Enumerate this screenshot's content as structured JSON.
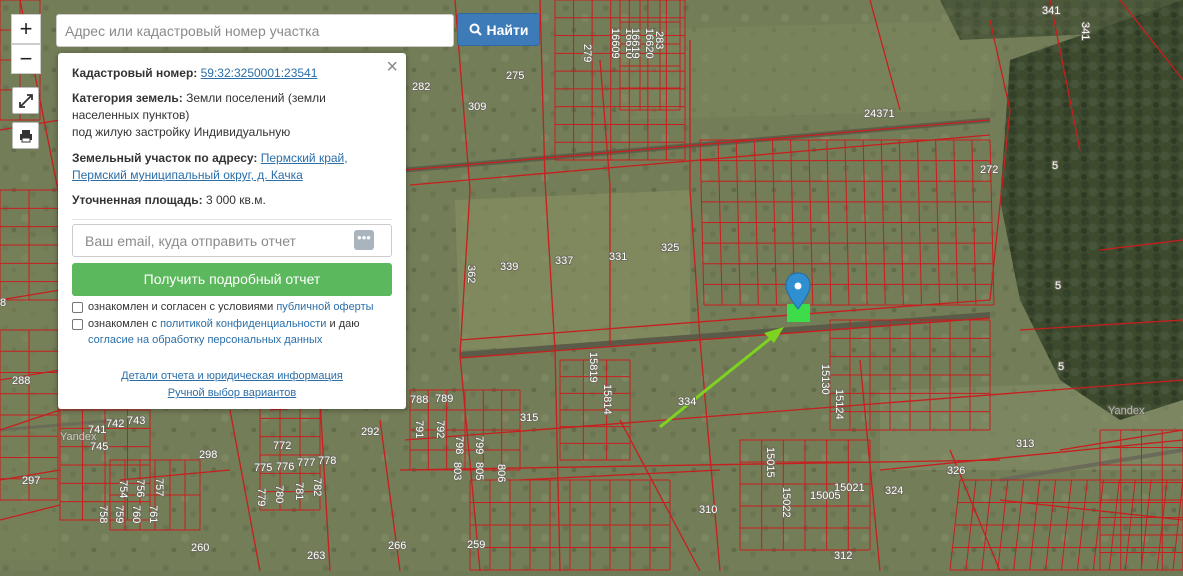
{
  "search": {
    "placeholder": "Адрес или кадастровый номер участка",
    "button_label": "Найти",
    "button_icon": "search-icon"
  },
  "map_controls": {
    "zoom_in": "+",
    "zoom_out": "−",
    "fullscreen_icon": "expand-icon",
    "print_icon": "printer-icon"
  },
  "popup": {
    "cadastral_label": "Кадастровый номер:",
    "cadastral_number": "59:32:3250001:23541",
    "category_label": "Категория земель:",
    "category_text1": "Земли поселений (земли",
    "category_text2": "населенных пунктов)",
    "category_text3": "под жилую застройку Индивидуальную",
    "address_label": "Земельный участок по адресу:",
    "address_link1": "Пермский край,",
    "address_link2": "Пермский муниципальный округ, д. Качка",
    "area_label": "Уточненная площадь:",
    "area_value": "3 000 кв.м.",
    "email_placeholder": "Ваш email, куда отправить отчет",
    "get_report_button": "Получить подробный отчет",
    "consent1_text": "ознакомлен и согласен с условиями",
    "consent1_link": "публичной оферты",
    "consent2_text": "ознакомлен с",
    "consent2_link": "политикой конфиденциальности",
    "consent2_text2": "и даю",
    "consent2_link2": "согласие на обработку персональных данных",
    "details_link": "Детали отчета и юридическая информация",
    "manual_link": "Ручной выбор вариантов"
  },
  "map_labels": {
    "items": [
      "341",
      "341",
      "275",
      "279",
      "16609",
      "16610",
      "16619",
      "16620",
      "283",
      "282",
      "309",
      "24371",
      "272",
      "5",
      "5",
      "5",
      "337",
      "339",
      "331",
      "325",
      "362",
      "288",
      "8",
      "315",
      "334",
      "15819",
      "15814",
      "15130",
      "15124",
      "292",
      "298",
      "297",
      "310",
      "324",
      "326",
      "313",
      "312",
      "259",
      "260",
      "263",
      "266",
      "15015",
      "15022",
      "15005",
      "15021",
      "788",
      "789",
      "772",
      "775",
      "776",
      "777",
      "778",
      "779",
      "780",
      "781",
      "782",
      "791",
      "792",
      "798",
      "799",
      "803",
      "805",
      "806",
      "741",
      "742",
      "743",
      "745",
      "754",
      "756",
      "757",
      "758",
      "759",
      "760",
      "761"
    ]
  },
  "watermark": {
    "left": "Yandex",
    "right": "Yandex"
  },
  "colors": {
    "boundary": "#c81e1e",
    "search_button": "#3d7ab8",
    "report_button": "#5cb85c",
    "marker": "#2f8fd0",
    "selected_parcel": "#3ddc4a",
    "arrow": "#7ed321"
  }
}
